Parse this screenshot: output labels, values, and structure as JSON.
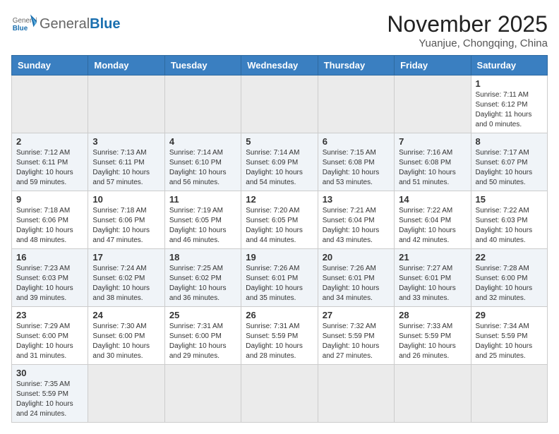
{
  "header": {
    "logo_general": "General",
    "logo_blue": "Blue",
    "month_title": "November 2025",
    "location": "Yuanjue, Chongqing, China"
  },
  "weekdays": [
    "Sunday",
    "Monday",
    "Tuesday",
    "Wednesday",
    "Thursday",
    "Friday",
    "Saturday"
  ],
  "rows": [
    [
      {
        "day": "",
        "info": ""
      },
      {
        "day": "",
        "info": ""
      },
      {
        "day": "",
        "info": ""
      },
      {
        "day": "",
        "info": ""
      },
      {
        "day": "",
        "info": ""
      },
      {
        "day": "",
        "info": ""
      },
      {
        "day": "1",
        "info": "Sunrise: 7:11 AM\nSunset: 6:12 PM\nDaylight: 11 hours and 0 minutes."
      }
    ],
    [
      {
        "day": "2",
        "info": "Sunrise: 7:12 AM\nSunset: 6:11 PM\nDaylight: 10 hours and 59 minutes."
      },
      {
        "day": "3",
        "info": "Sunrise: 7:13 AM\nSunset: 6:11 PM\nDaylight: 10 hours and 57 minutes."
      },
      {
        "day": "4",
        "info": "Sunrise: 7:14 AM\nSunset: 6:10 PM\nDaylight: 10 hours and 56 minutes."
      },
      {
        "day": "5",
        "info": "Sunrise: 7:14 AM\nSunset: 6:09 PM\nDaylight: 10 hours and 54 minutes."
      },
      {
        "day": "6",
        "info": "Sunrise: 7:15 AM\nSunset: 6:08 PM\nDaylight: 10 hours and 53 minutes."
      },
      {
        "day": "7",
        "info": "Sunrise: 7:16 AM\nSunset: 6:08 PM\nDaylight: 10 hours and 51 minutes."
      },
      {
        "day": "8",
        "info": "Sunrise: 7:17 AM\nSunset: 6:07 PM\nDaylight: 10 hours and 50 minutes."
      }
    ],
    [
      {
        "day": "9",
        "info": "Sunrise: 7:18 AM\nSunset: 6:06 PM\nDaylight: 10 hours and 48 minutes."
      },
      {
        "day": "10",
        "info": "Sunrise: 7:18 AM\nSunset: 6:06 PM\nDaylight: 10 hours and 47 minutes."
      },
      {
        "day": "11",
        "info": "Sunrise: 7:19 AM\nSunset: 6:05 PM\nDaylight: 10 hours and 46 minutes."
      },
      {
        "day": "12",
        "info": "Sunrise: 7:20 AM\nSunset: 6:05 PM\nDaylight: 10 hours and 44 minutes."
      },
      {
        "day": "13",
        "info": "Sunrise: 7:21 AM\nSunset: 6:04 PM\nDaylight: 10 hours and 43 minutes."
      },
      {
        "day": "14",
        "info": "Sunrise: 7:22 AM\nSunset: 6:04 PM\nDaylight: 10 hours and 42 minutes."
      },
      {
        "day": "15",
        "info": "Sunrise: 7:22 AM\nSunset: 6:03 PM\nDaylight: 10 hours and 40 minutes."
      }
    ],
    [
      {
        "day": "16",
        "info": "Sunrise: 7:23 AM\nSunset: 6:03 PM\nDaylight: 10 hours and 39 minutes."
      },
      {
        "day": "17",
        "info": "Sunrise: 7:24 AM\nSunset: 6:02 PM\nDaylight: 10 hours and 38 minutes."
      },
      {
        "day": "18",
        "info": "Sunrise: 7:25 AM\nSunset: 6:02 PM\nDaylight: 10 hours and 36 minutes."
      },
      {
        "day": "19",
        "info": "Sunrise: 7:26 AM\nSunset: 6:01 PM\nDaylight: 10 hours and 35 minutes."
      },
      {
        "day": "20",
        "info": "Sunrise: 7:26 AM\nSunset: 6:01 PM\nDaylight: 10 hours and 34 minutes."
      },
      {
        "day": "21",
        "info": "Sunrise: 7:27 AM\nSunset: 6:01 PM\nDaylight: 10 hours and 33 minutes."
      },
      {
        "day": "22",
        "info": "Sunrise: 7:28 AM\nSunset: 6:00 PM\nDaylight: 10 hours and 32 minutes."
      }
    ],
    [
      {
        "day": "23",
        "info": "Sunrise: 7:29 AM\nSunset: 6:00 PM\nDaylight: 10 hours and 31 minutes."
      },
      {
        "day": "24",
        "info": "Sunrise: 7:30 AM\nSunset: 6:00 PM\nDaylight: 10 hours and 30 minutes."
      },
      {
        "day": "25",
        "info": "Sunrise: 7:31 AM\nSunset: 6:00 PM\nDaylight: 10 hours and 29 minutes."
      },
      {
        "day": "26",
        "info": "Sunrise: 7:31 AM\nSunset: 5:59 PM\nDaylight: 10 hours and 28 minutes."
      },
      {
        "day": "27",
        "info": "Sunrise: 7:32 AM\nSunset: 5:59 PM\nDaylight: 10 hours and 27 minutes."
      },
      {
        "day": "28",
        "info": "Sunrise: 7:33 AM\nSunset: 5:59 PM\nDaylight: 10 hours and 26 minutes."
      },
      {
        "day": "29",
        "info": "Sunrise: 7:34 AM\nSunset: 5:59 PM\nDaylight: 10 hours and 25 minutes."
      }
    ],
    [
      {
        "day": "30",
        "info": "Sunrise: 7:35 AM\nSunset: 5:59 PM\nDaylight: 10 hours and 24 minutes."
      },
      {
        "day": "",
        "info": ""
      },
      {
        "day": "",
        "info": ""
      },
      {
        "day": "",
        "info": ""
      },
      {
        "day": "",
        "info": ""
      },
      {
        "day": "",
        "info": ""
      },
      {
        "day": "",
        "info": ""
      }
    ]
  ]
}
